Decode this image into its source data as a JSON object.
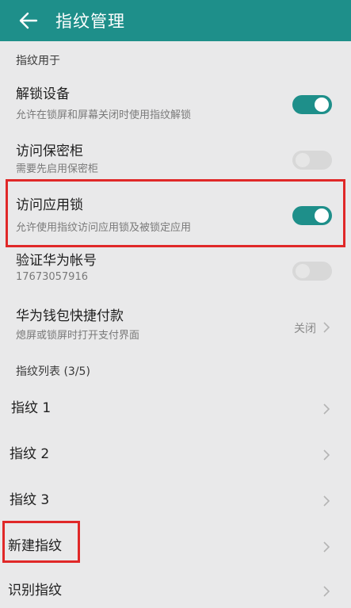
{
  "header": {
    "title": "指纹管理",
    "back_icon": "back-arrow-icon"
  },
  "sections": {
    "fingerprint_use": "指纹用于",
    "fingerprint_list": "指纹列表 (3/5)"
  },
  "settings": [
    {
      "label": "解锁设备",
      "sub": "允许在锁屏和屏幕关闭时使用指纹解锁",
      "toggle": "on"
    },
    {
      "label": "访问保密柜",
      "sub": "需要先启用保密柜",
      "toggle": "off"
    },
    {
      "label": "访问应用锁",
      "sub": "允许使用指纹访问应用锁及被锁定应用",
      "toggle": "on"
    },
    {
      "label": "验证华为帐号",
      "sub": "17673057916",
      "toggle": "off"
    },
    {
      "label": "华为钱包快捷付款",
      "sub": "熄屏或锁屏时打开支付界面",
      "value": "关闭"
    }
  ],
  "fingerprints": [
    {
      "label": "指纹 1"
    },
    {
      "label": "指纹 2"
    },
    {
      "label": "指纹 3"
    },
    {
      "label": "新建指纹"
    },
    {
      "label": "识别指纹"
    }
  ],
  "colors": {
    "accent": "#1e8f8a",
    "highlight": "#e02828",
    "background": "#e9e9ea"
  }
}
